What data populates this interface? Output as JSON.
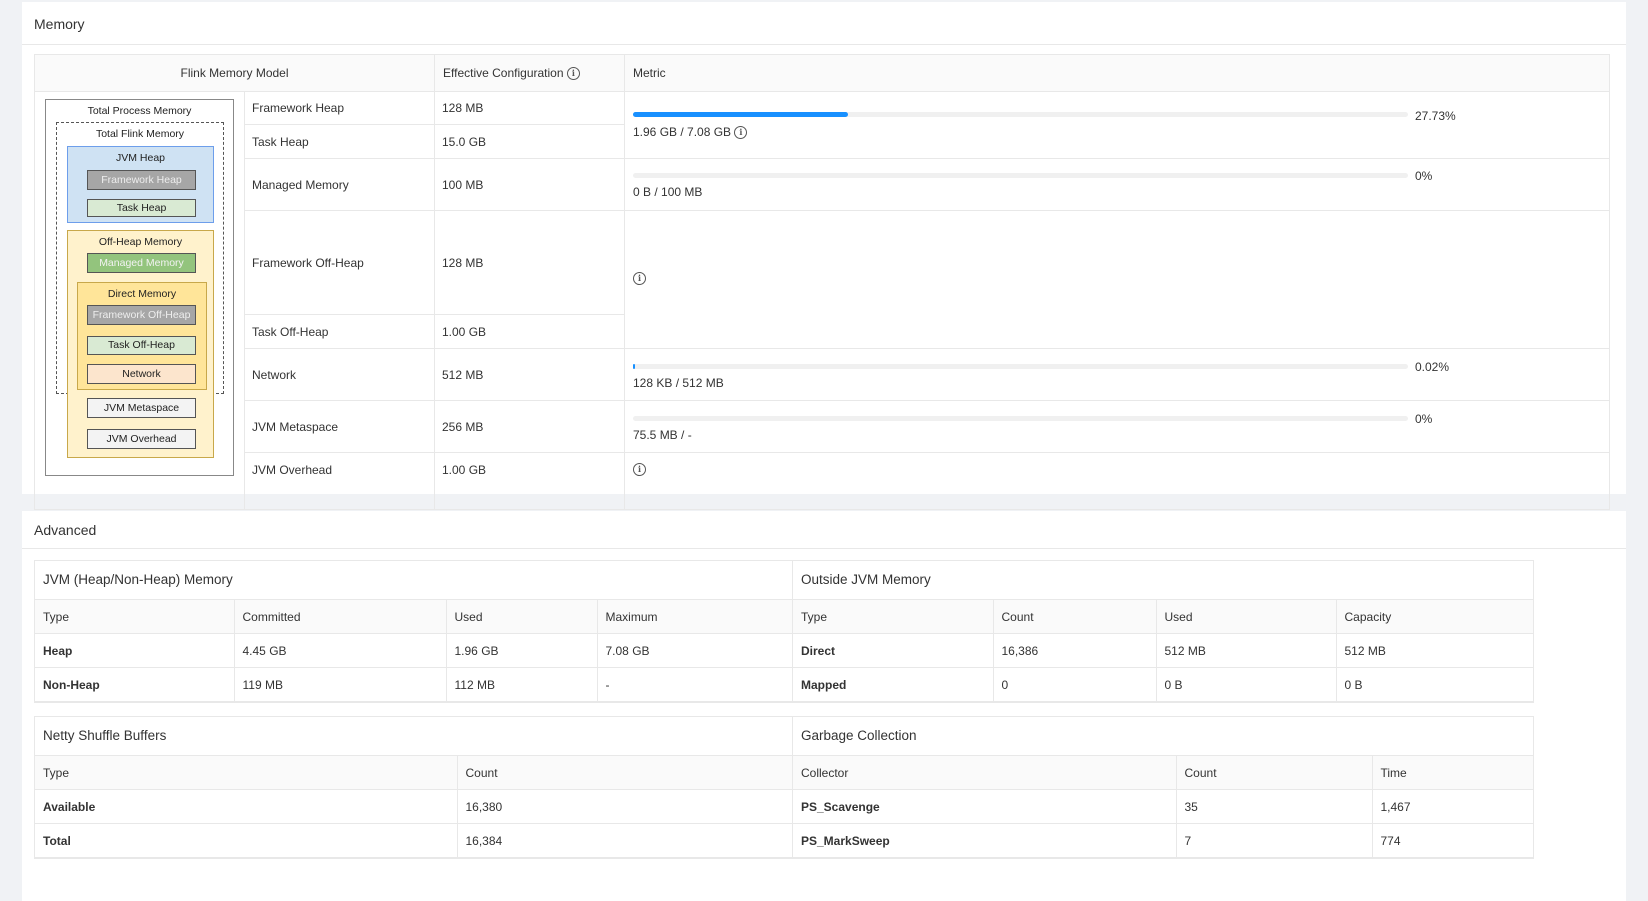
{
  "memory": {
    "title": "Memory",
    "headers": {
      "model": "Flink Memory Model",
      "config": "Effective Configuration",
      "metric": "Metric"
    },
    "diagram": {
      "total_process": "Total Process Memory",
      "total_flink": "Total Flink Memory",
      "jvm_heap": "JVM Heap",
      "framework_heap": "Framework Heap",
      "task_heap": "Task Heap",
      "off_heap": "Off-Heap Memory",
      "managed_memory": "Managed Memory",
      "direct_memory": "Direct Memory",
      "framework_off_heap": "Framework Off-Heap",
      "task_off_heap": "Task Off-Heap",
      "network": "Network",
      "jvm_metaspace": "JVM Metaspace",
      "jvm_overhead": "JVM Overhead"
    },
    "rows": [
      {
        "label": "Framework Heap",
        "value": "128 MB"
      },
      {
        "label": "Task Heap",
        "value": "15.0 GB"
      },
      {
        "label": "Managed Memory",
        "value": "100 MB"
      },
      {
        "label": "Framework Off-Heap",
        "value": "128 MB"
      },
      {
        "label": "Task Off-Heap",
        "value": "1.00 GB"
      },
      {
        "label": "Network",
        "value": "512 MB"
      },
      {
        "label": "JVM Metaspace",
        "value": "256 MB"
      },
      {
        "label": "JVM Overhead",
        "value": "1.00 GB"
      }
    ],
    "metrics": {
      "heap": {
        "percent_text": "27.73%",
        "fraction": 0.2773,
        "usage": "1.96 GB / 7.08 GB"
      },
      "managed": {
        "percent_text": "0%",
        "fraction": 0,
        "usage": "0 B / 100 MB"
      },
      "network": {
        "percent_text": "0.02%",
        "fraction": 0.0002,
        "usage": "128 KB / 512 MB"
      },
      "metaspace": {
        "percent_text": "0%",
        "fraction": 0,
        "usage": "75.5 MB / -"
      }
    },
    "colors": {
      "bar": "#1890ff",
      "jvm_heap_bg": "#cfe2f3",
      "off_heap_bg": "#fff2cc",
      "direct_bg": "#ffe599",
      "framework_box": "#a6a6a6",
      "task_box": "#d9ead3",
      "managed_box": "#93c47d",
      "network_box": "#fce5cd"
    }
  },
  "advanced": {
    "title": "Advanced",
    "jvm": {
      "title": "JVM (Heap/Non-Heap) Memory",
      "columns": [
        "Type",
        "Committed",
        "Used",
        "Maximum"
      ],
      "rows": [
        [
          "Heap",
          "4.45 GB",
          "1.96 GB",
          "7.08 GB"
        ],
        [
          "Non-Heap",
          "119 MB",
          "112 MB",
          "-"
        ]
      ]
    },
    "outside": {
      "title": "Outside JVM Memory",
      "columns": [
        "Type",
        "Count",
        "Used",
        "Capacity"
      ],
      "rows": [
        [
          "Direct",
          "16,386",
          "512 MB",
          "512 MB"
        ],
        [
          "Mapped",
          "0",
          "0 B",
          "0 B"
        ]
      ]
    },
    "netty": {
      "title": "Netty Shuffle Buffers",
      "columns": [
        "Type",
        "Count"
      ],
      "rows": [
        [
          "Available",
          "16,380"
        ],
        [
          "Total",
          "16,384"
        ]
      ]
    },
    "gc": {
      "title": "Garbage Collection",
      "columns": [
        "Collector",
        "Count",
        "Time"
      ],
      "rows": [
        [
          "PS_Scavenge",
          "35",
          "1,467"
        ],
        [
          "PS_MarkSweep",
          "7",
          "774"
        ]
      ]
    }
  }
}
